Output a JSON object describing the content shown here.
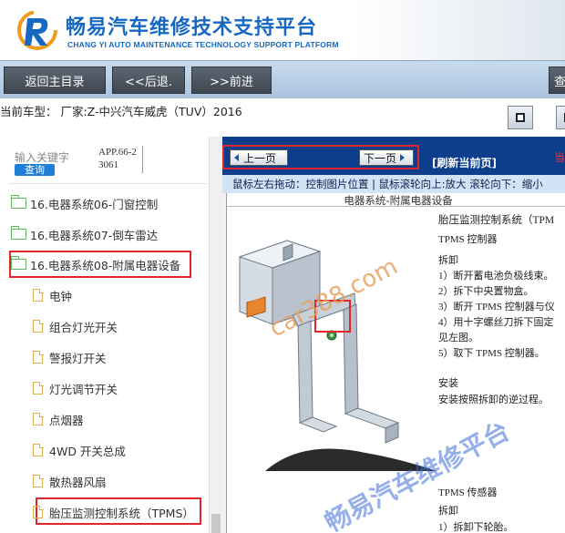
{
  "header": {
    "title": "畅易汽车维修技术支持平台",
    "subtitle": "CHANG YI AUTO MAINTENANCE TECHNOLOGY SUPPORT PLATFORM",
    "logo_icon": "cy-logo-icon",
    "brand_color": "#1768c2"
  },
  "nav": {
    "home_label": "返回主目录",
    "back_label": "<<后退.",
    "forward_label": ">>前进",
    "query_label": "查"
  },
  "vehicle": {
    "label": "当前车型：  厂家:Z-中兴汽车威虎（TUV）2016"
  },
  "sidebar": {
    "search_label": "输入关键字",
    "search_button": "查询",
    "search_code": "APP.66-23061",
    "items": [
      {
        "label": "16.电器系统06-门窗控制",
        "icon": "folder-icon"
      },
      {
        "label": "16.电器系统07-倒车雷达",
        "icon": "folder-icon"
      },
      {
        "label": "16.电器系统08-附属电器设备",
        "icon": "folder-open-icon",
        "highlighted": true
      },
      {
        "label": "电钟",
        "icon": "document-icon"
      },
      {
        "label": "组合灯光开关",
        "icon": "document-icon"
      },
      {
        "label": "警报灯开关",
        "icon": "document-icon"
      },
      {
        "label": "灯光调节开关",
        "icon": "document-icon"
      },
      {
        "label": "点烟器",
        "icon": "document-icon"
      },
      {
        "label": "4WD 开关总成",
        "icon": "document-icon"
      },
      {
        "label": "散热器风扇",
        "icon": "document-icon"
      },
      {
        "label": "胎压监测控制系统（TPMS）",
        "icon": "document-icon",
        "highlighted": true
      }
    ]
  },
  "content": {
    "prev_label": "上一页",
    "next_label": "下一页",
    "refresh_label": "[刷新当前页]",
    "current_label": "当",
    "hint": "鼠标左右拖动：控制图片位置 | 鼠标滚轮向上:放大   滚轮向下：缩小",
    "doc_title": "电器系统-附属电器设备",
    "doc_lines": [
      "胎压监测控制系统（TPM",
      "TPMS  控制器",
      "拆卸",
      "1）断开蓄电池负极线束。",
      "2）拆下中央置物盒。",
      "3）断开 TPMS 控制器与仪",
      "4）用十字螺丝刀拆下固定",
      "见左图。",
      "5）取下 TPMS 控制器。",
      "安装",
      "安装按照拆卸的逆过程。",
      "TPMS  传感器",
      "拆卸",
      "1）拆卸下轮胎。"
    ],
    "watermark_site": "car388.com",
    "watermark_platform": "畅易汽车维修平台",
    "highlight_color": "#e0262a",
    "pager_bg": "#0d3e8c"
  }
}
